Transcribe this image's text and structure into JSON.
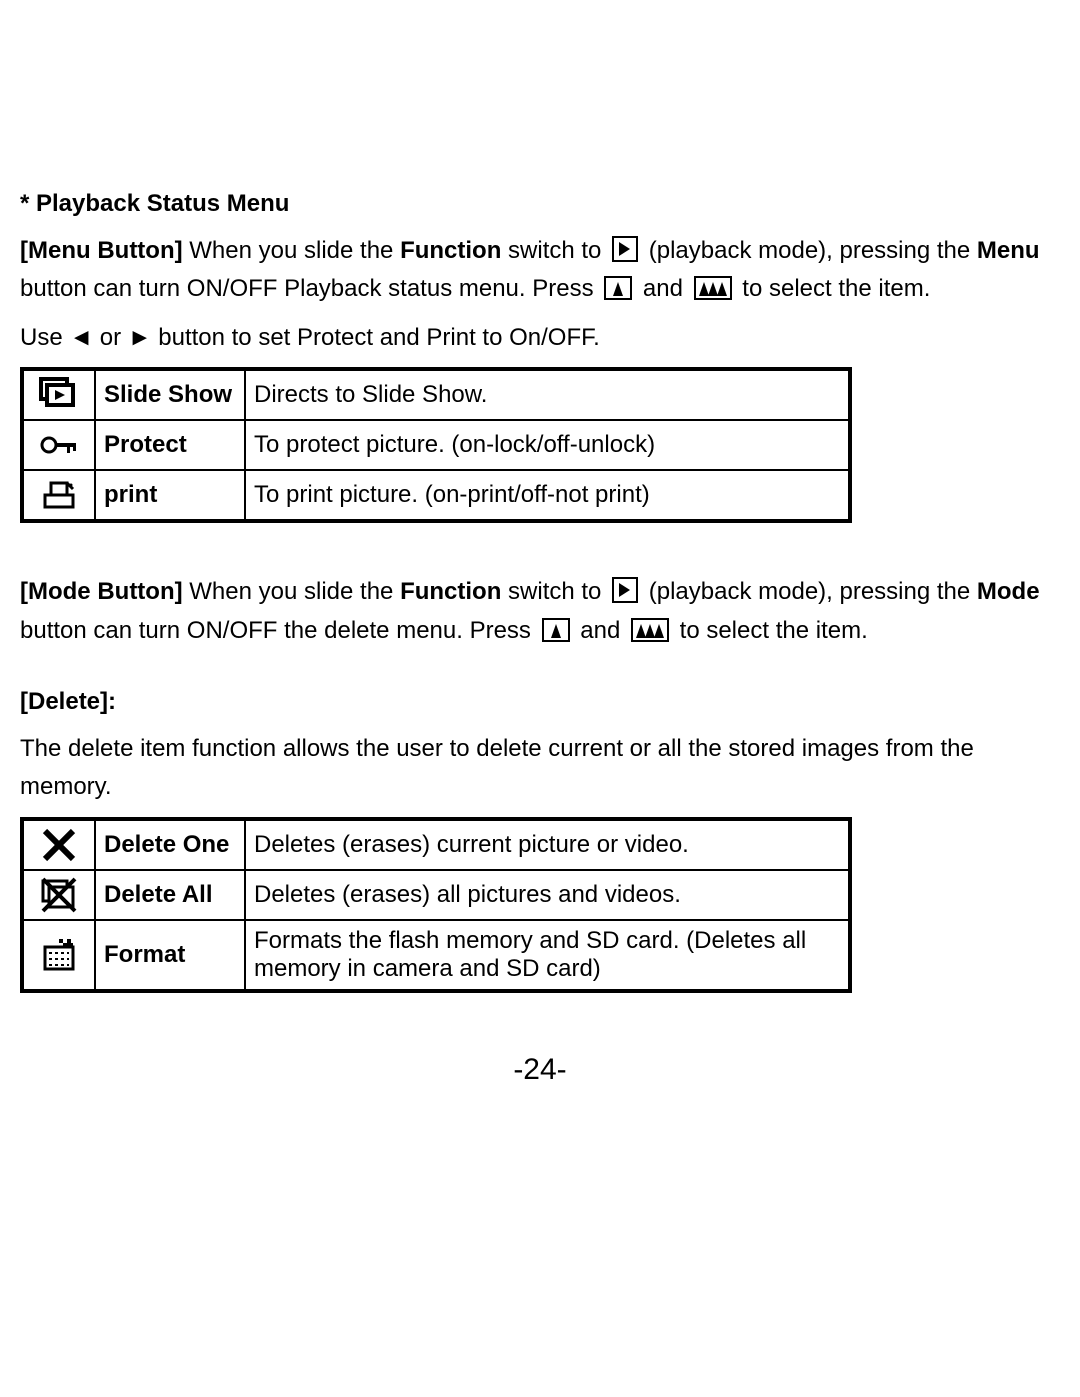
{
  "heading1": "* Playback Status Menu",
  "p1": {
    "seg1a": "[Menu Button]",
    "seg1b": " When you slide the ",
    "seg1c": "Function",
    "seg1d": " switch to ",
    "seg1e": " (playback mode), pressing the ",
    "seg2a": "Menu",
    "seg2b": " button can turn ON/OFF Playback status menu. Press  ",
    "seg2c": "  and  ",
    "seg2d": "  to select the item."
  },
  "p2": {
    "a": "Use ",
    "left": "◄",
    "or": " or ",
    "right": "►",
    "b": " button to set Protect and Print to On/OFF."
  },
  "table1": {
    "rows": [
      {
        "label": "Slide Show",
        "desc": "Directs to Slide Show."
      },
      {
        "label": "Protect",
        "desc": "To protect picture. (on-lock/off-unlock)"
      },
      {
        "label": "print",
        "desc": "To print picture. (on-print/off-not print)"
      }
    ]
  },
  "p3": {
    "seg1a": "[Mode Button]",
    "seg1b": " When you slide the ",
    "seg1c": "Function",
    "seg1d": " switch to ",
    "seg1e": " (playback mode), pressing the ",
    "seg2a": "Mode",
    "seg2b": " button can turn ON/OFF the delete menu. Press  ",
    "seg2c": " and  ",
    "seg2d": "  to select the item."
  },
  "heading2": "[Delete]:",
  "p4": "The delete item function allows the user to delete current or all the stored images from the memory.",
  "table2": {
    "rows": [
      {
        "label": "Delete One",
        "desc": "Deletes (erases) current picture or video."
      },
      {
        "label": "Delete All",
        "desc": "Deletes (erases) all pictures and videos."
      },
      {
        "label": "Format",
        "desc": "Formats the flash memory and SD card. (Deletes all memory in camera and SD card)"
      }
    ]
  },
  "pagenum": "-24-"
}
